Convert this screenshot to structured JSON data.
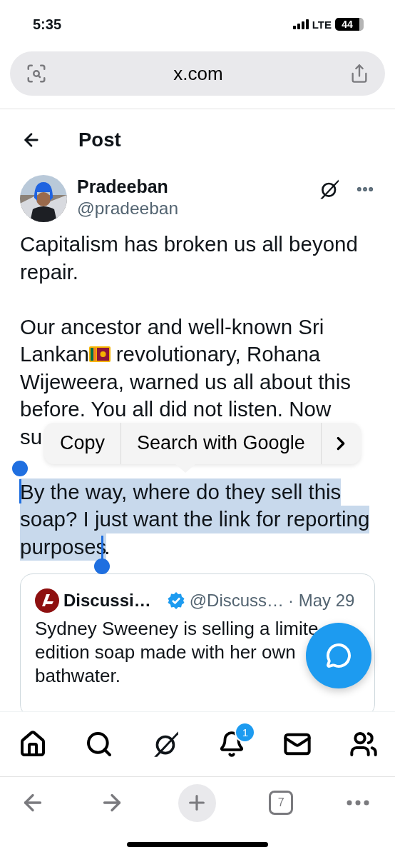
{
  "status_bar": {
    "time": "5:35",
    "network": "LTE",
    "battery": "44"
  },
  "browser": {
    "url": "x.com",
    "tabs_count": "7"
  },
  "header": {
    "title": "Post"
  },
  "post": {
    "author": {
      "name": "Pradeeban",
      "handle": "@pradeeban"
    },
    "paragraphs": [
      {
        "kind": "plain",
        "lines": [
          {
            "text": "Capitalism has broken us all beyond"
          },
          {
            "text": "repair."
          }
        ]
      },
      {
        "kind": "plain",
        "lines": [
          {
            "text": "Our ancestor and well-known Sri"
          },
          {
            "kind": "flagged",
            "text": "Lankan",
            "rest": "revolutionary, Rohana"
          },
          {
            "text": "Wijeweera, warned us all about this"
          },
          {
            "text": "before. You all did not listen. Now"
          },
          {
            "text": "su"
          }
        ]
      },
      {
        "kind": "selection",
        "lines": [
          "By the way, where do they sell this",
          "soap? I just want the link for reporting",
          "purposes"
        ],
        "tail": ".",
        "selected": true
      }
    ],
    "quote": {
      "name": "Discussi…",
      "handle": "@Discuss…",
      "date": "· May 29",
      "lines": [
        "Sydney Sweeney is selling a limite",
        "edition soap made with her own",
        "bathwater."
      ]
    }
  },
  "context_menu": {
    "items": [
      "Copy",
      "Search with Google"
    ]
  },
  "nav": {
    "notifications": "1"
  }
}
